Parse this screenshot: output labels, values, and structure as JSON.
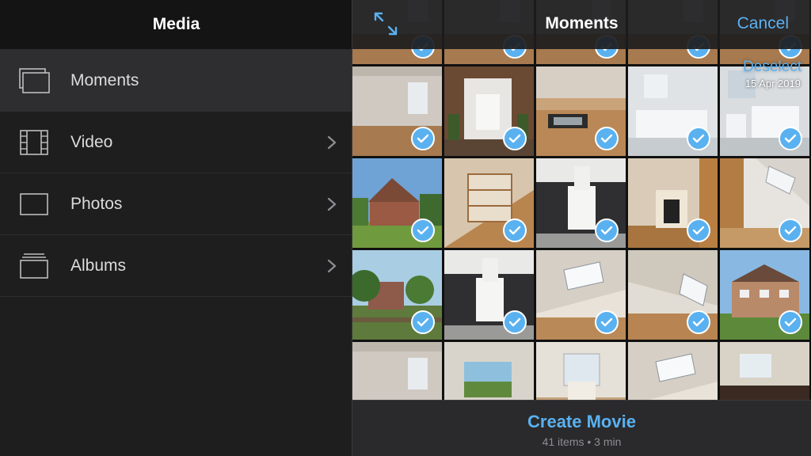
{
  "left": {
    "title": "Media",
    "items": [
      {
        "label": "Moments",
        "icon": "moments-icon",
        "selected": true,
        "has_chevron": false
      },
      {
        "label": "Video",
        "icon": "film-icon",
        "selected": false,
        "has_chevron": true
      },
      {
        "label": "Photos",
        "icon": "photo-icon",
        "selected": false,
        "has_chevron": true
      },
      {
        "label": "Albums",
        "icon": "albums-icon",
        "selected": false,
        "has_chevron": true
      }
    ]
  },
  "right": {
    "title": "Moments",
    "cancel_label": "Cancel",
    "expand_icon": "expand-arrows-icon",
    "deselect_label": "Deselect",
    "date": "15 Apr 2019",
    "create_label": "Create Movie",
    "info": "41 items • 3 min"
  },
  "colors": {
    "accent": "#5ab1f0",
    "background": "#1c1c1e",
    "selected_row": "#2e2e30"
  },
  "grid": {
    "rows": [
      {
        "scenes": [
          "room",
          "door",
          "kitchen",
          "bath",
          "bath2"
        ],
        "checked": true
      },
      {
        "scenes": [
          "house",
          "stairs",
          "bathroom-dark",
          "fireplace",
          "loft"
        ],
        "checked": true
      },
      {
        "scenes": [
          "garden",
          "bathroom-dark",
          "skylight",
          "skylight2",
          "house2"
        ],
        "checked": true
      },
      {
        "scenes": [
          "room",
          "garden-window",
          "window-room",
          "skylight",
          "kitchen2"
        ],
        "checked": false
      }
    ]
  }
}
